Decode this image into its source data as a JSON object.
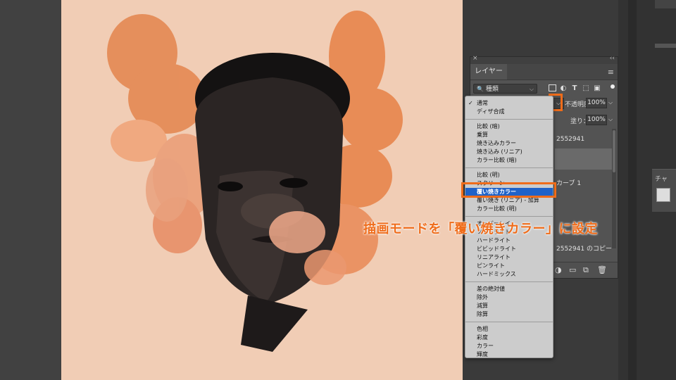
{
  "layers_panel": {
    "close_glyph": "×",
    "collapse_glyph": "‹‹",
    "tab_label": "レイヤー",
    "menu_glyph": "≡",
    "filter": {
      "search_glyph": "🔍",
      "kind_label": "種類",
      "caret": "⌵"
    },
    "filter_icons": [
      "image-filter-icon",
      "adjustment-filter-icon",
      "type-filter-icon",
      "shape-filter-icon",
      "smart-object-filter-icon",
      "filter-toggle-icon"
    ],
    "blend_caret": "⌵",
    "opacity_label": "不透明度：",
    "opacity_value": "100%",
    "fill_label": "塗り：",
    "fill_value": "100%",
    "layers": [
      {
        "name": "2552941"
      },
      {
        "name": "カーブ 1"
      },
      {
        "name": "2552941 のコピー"
      }
    ],
    "footer_icons": [
      "adjustment-layer-icon",
      "group-folder-icon",
      "new-layer-icon",
      "trash-icon"
    ]
  },
  "blend_menu": {
    "groups": [
      [
        "通常",
        "ディザ合成"
      ],
      [
        "比較 (暗)",
        "乗算",
        "焼き込みカラー",
        "焼き込み (リニア)",
        "カラー比較 (暗)"
      ],
      [
        "比較 (明)",
        "スクリーン",
        "覆い焼きカラー",
        "覆い焼き (リニア) - 加算",
        "カラー比較 (明)"
      ],
      [
        "オーバーレイ",
        "ソフトライト",
        "ハードライト",
        "ビビッドライト",
        "リニアライト",
        "ピンライト",
        "ハードミックス"
      ],
      [
        "差の絶対値",
        "除外",
        "減算",
        "除算"
      ],
      [
        "色相",
        "彩度",
        "カラー",
        "輝度"
      ]
    ],
    "checked": "通常",
    "selected": "覆い焼きカラー"
  },
  "annotation": "描画モードを「覆い焼きカラー」に設定",
  "right_dock": {
    "channel_tab_label": "チャ"
  },
  "colors": {
    "accent_orange": "#ef6c1a",
    "menu_selection": "#1f62c8",
    "canvas_bg": "#f1cdb5"
  }
}
